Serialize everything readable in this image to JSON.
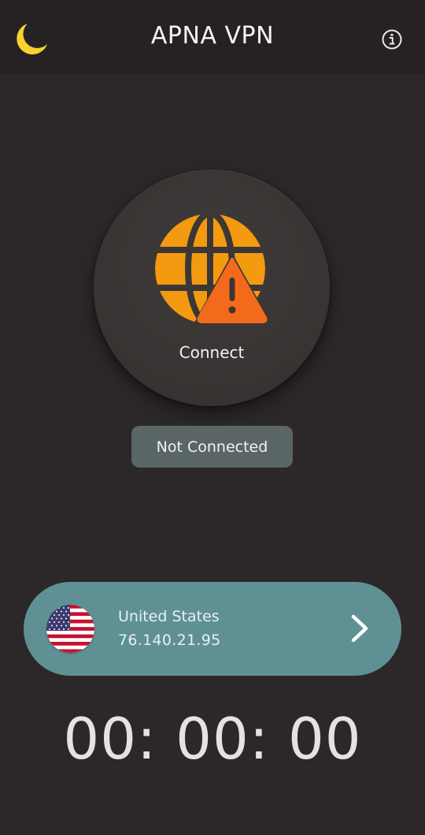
{
  "app": {
    "title": "APNA VPN"
  },
  "icons": {
    "theme_toggle": "moon-icon",
    "info": "info-icon",
    "status": "globe-warning-icon",
    "server_flag": "us-flag-icon",
    "server_arrow": "chevron-right-icon"
  },
  "colors": {
    "background": "#2c2829",
    "appbar": "#262223",
    "moon": "#f6d32d",
    "globe": "#f49a11",
    "warning": "#f36a1a",
    "status_pill": "#5a6566",
    "server_card": "#5f9194",
    "timer": "#e5e1e8"
  },
  "connect_button": {
    "label": "Connect"
  },
  "status": {
    "text": "Not Connected"
  },
  "server": {
    "country": "United States",
    "ip": "76.140.21.95"
  },
  "timer": {
    "value": "00: 00: 00"
  }
}
